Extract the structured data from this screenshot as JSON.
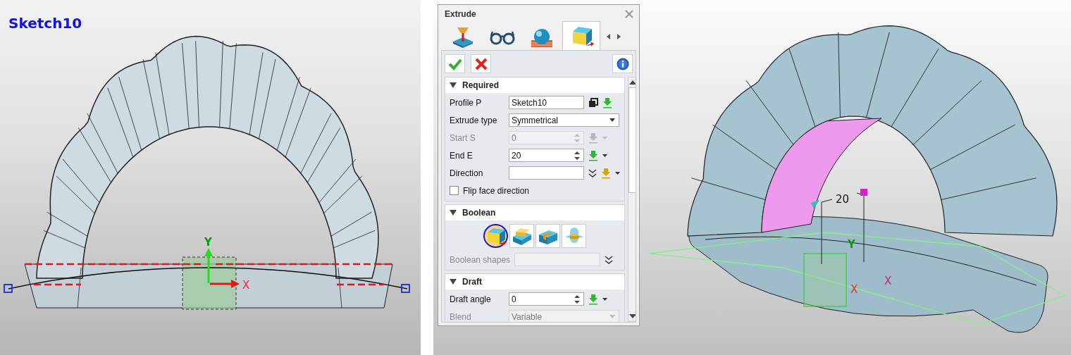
{
  "sketch_view": {
    "title": "Sketch10",
    "x_axis": "X",
    "y_axis": "Y"
  },
  "dialog": {
    "title": "Extrude",
    "tabs": [
      {
        "kind": "joystick",
        "selected": false
      },
      {
        "kind": "glasses",
        "selected": false
      },
      {
        "kind": "sphere",
        "selected": false
      },
      {
        "kind": "extrude",
        "selected": true
      }
    ],
    "sections": [
      {
        "title": "Required",
        "expanded": true,
        "rows": [
          {
            "kind": "input",
            "label": "Profile P",
            "value": "Sketch10",
            "disabled": false
          },
          {
            "kind": "select",
            "label": "Extrude type",
            "value": "Symmetrical",
            "disabled": false
          },
          {
            "kind": "spinner",
            "label": "Start S",
            "value": "0",
            "disabled": true
          },
          {
            "kind": "spinner",
            "label": "End E",
            "value": "20",
            "disabled": false
          },
          {
            "kind": "direction",
            "label": "Direction",
            "disabled": false
          },
          {
            "kind": "checkbox",
            "label": "Flip face direction",
            "checked": false
          }
        ]
      },
      {
        "title": "Boolean",
        "expanded": true,
        "rows": [
          {
            "kind": "boolean_buttons",
            "options": [
              {
                "kind": "base",
                "selected": true
              },
              {
                "kind": "add",
                "selected": false
              },
              {
                "kind": "remove",
                "selected": false
              },
              {
                "kind": "intersect",
                "selected": false
              }
            ]
          },
          {
            "kind": "shapes",
            "label": "Boolean shapes",
            "disabled": true
          }
        ]
      },
      {
        "title": "Draft",
        "expanded": true,
        "rows": [
          {
            "kind": "spinner",
            "label": "Draft angle",
            "value": "0",
            "disabled": false
          },
          {
            "kind": "select",
            "label": "Blend",
            "value": "Variable",
            "disabled": true
          }
        ]
      }
    ]
  },
  "model_view": {
    "dimension": "20",
    "y_axis": "Y",
    "x_axis": "X",
    "x_axis_2": "X"
  }
}
